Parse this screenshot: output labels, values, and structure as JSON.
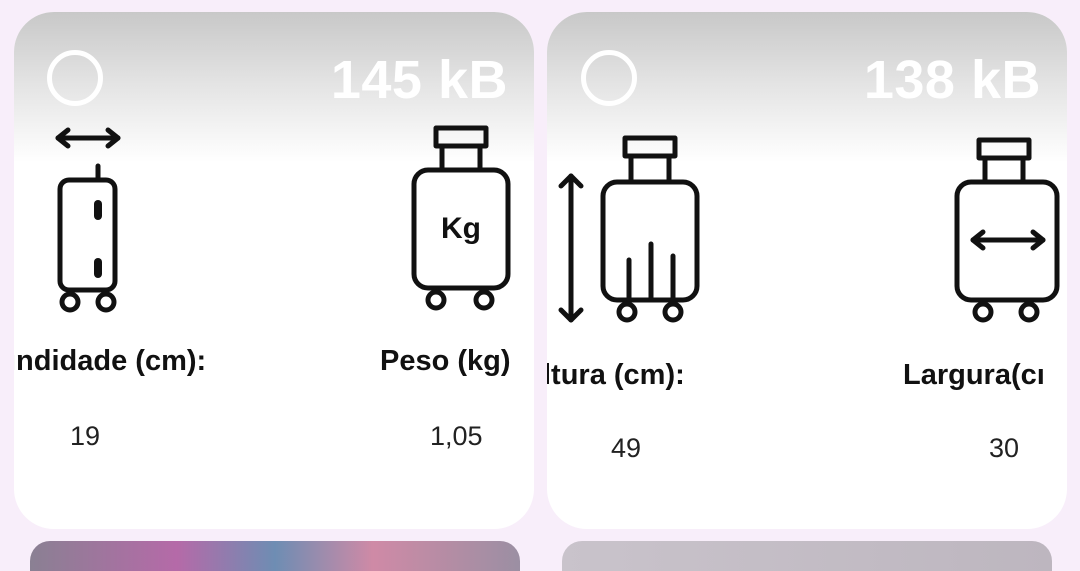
{
  "cards": [
    {
      "size": "145 kB",
      "attributes": [
        {
          "icon": "luggage-depth-icon",
          "label": "ındidade (cm):",
          "value": "19"
        },
        {
          "icon": "luggage-weight-icon",
          "label": "Peso (kg)",
          "value": "1,05",
          "icon_text": "Kg"
        }
      ]
    },
    {
      "size": "138 kB",
      "attributes": [
        {
          "icon": "luggage-height-icon",
          "label": "ltura (cm):",
          "value": "49"
        },
        {
          "icon": "luggage-width-icon",
          "label": "Largura(cı",
          "value": "30"
        }
      ]
    }
  ]
}
